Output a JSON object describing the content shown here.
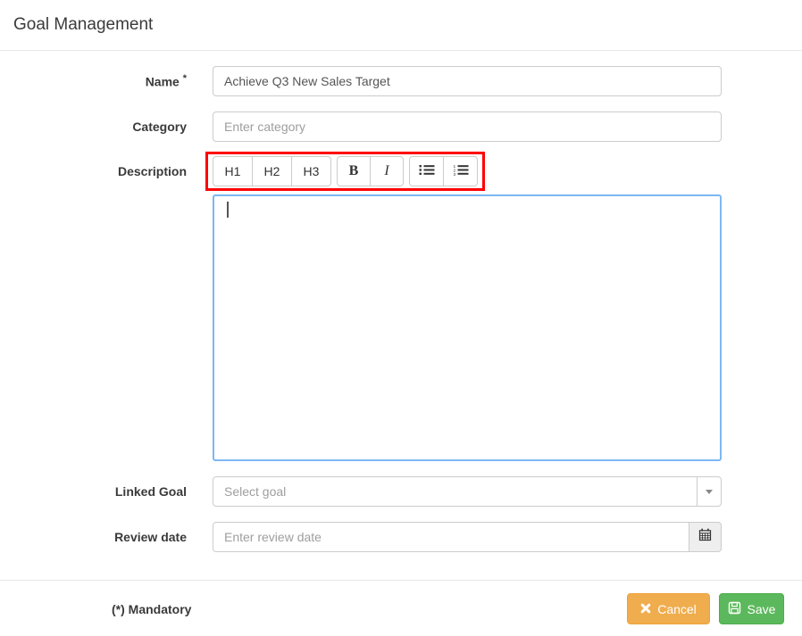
{
  "window": {
    "title": "Goal Management"
  },
  "colors": {
    "highlight_border": "#ff0000",
    "editor_focus_border": "#7db7f3",
    "cancel_button_bg": "#f0ad4e",
    "save_button_bg": "#5cb85c",
    "label_text": "#3a3a3a",
    "placeholder_text": "#9e9e9e",
    "divider": "#e8e8e8"
  },
  "form": {
    "name": {
      "label": "Name",
      "required_marker": "*",
      "value": "Achieve Q3 New Sales Target"
    },
    "category": {
      "label": "Category",
      "placeholder": "Enter category"
    },
    "description": {
      "label": "Description",
      "toolbar": {
        "h1": "H1",
        "h2": "H2",
        "h3": "H3",
        "bold": "B",
        "italic": "I",
        "unordered_list_icon": "list-ul-icon",
        "ordered_list_icon": "list-ol-icon"
      },
      "editor_value": ""
    },
    "linked_goal": {
      "label": "Linked Goal",
      "placeholder": "Select goal",
      "arrow_icon": "caret-down-icon"
    },
    "review_date": {
      "label": "Review date",
      "placeholder": "Enter review date",
      "calendar_icon": "calendar-icon"
    }
  },
  "footer": {
    "mandatory_note": "(*) Mandatory",
    "cancel": {
      "label": "Cancel",
      "icon": "x-icon"
    },
    "save": {
      "label": "Save",
      "icon": "floppy-disk-icon"
    }
  }
}
